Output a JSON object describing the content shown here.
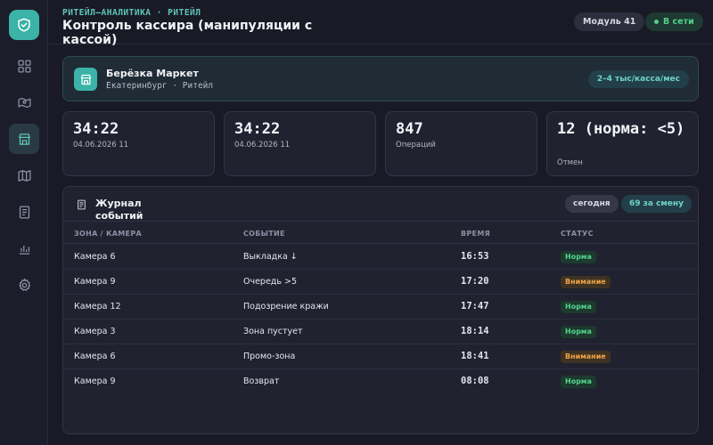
{
  "header": {
    "breadcrumb": "РИТЕЙЛ–АНАЛИТИКА · РИТЕЙЛ",
    "title": "Контроль кассира (манипуляции с кассой)",
    "module_chip": "Модуль 41",
    "online_chip": "В сети"
  },
  "sidebar": {
    "logo_icon": "shield-check-icon",
    "items": [
      {
        "icon": "dashboard-icon",
        "active": false
      },
      {
        "icon": "map-pin-icon",
        "active": false
      },
      {
        "icon": "store-icon",
        "active": true
      },
      {
        "icon": "map-icon",
        "active": false
      },
      {
        "icon": "document-icon",
        "active": false
      },
      {
        "icon": "bar-chart-icon",
        "active": false
      },
      {
        "icon": "gear-icon",
        "active": false
      }
    ]
  },
  "store": {
    "icon": "store-icon",
    "name": "Берёзка Маркет",
    "subtitle": "Екатеринбург · Ритейл",
    "badge": "2–4 тыс/касса/мес"
  },
  "stats": [
    {
      "value": "34:22",
      "label": "04.06.2026 11"
    },
    {
      "value": "34:22",
      "label": "04.06.2026 11"
    },
    {
      "value": "847",
      "label": "Операций"
    },
    {
      "value": "12 (норма: <5)",
      "label": "Отмен"
    }
  ],
  "journal": {
    "icon": "document-icon",
    "title": "Журнал событий",
    "filter_today": "сегодня",
    "shift_count": "69 за смену",
    "columns": [
      "ЗОНА / КАМЕРА",
      "СОБЫТИЕ",
      "ВРЕМЯ",
      "СТАТУС"
    ],
    "rows": [
      {
        "zone": "Камера 6",
        "event": "Выкладка ↓",
        "time": "16:53",
        "status": "Норма",
        "kind": "ok"
      },
      {
        "zone": "Камера 9",
        "event": "Очередь >5",
        "time": "17:20",
        "status": "Внимание",
        "kind": "warn"
      },
      {
        "zone": "Камера 12",
        "event": "Подозрение кражи",
        "time": "17:47",
        "status": "Норма",
        "kind": "ok"
      },
      {
        "zone": "Камера 3",
        "event": "Зона пустует",
        "time": "18:14",
        "status": "Норма",
        "kind": "ok"
      },
      {
        "zone": "Камера 6",
        "event": "Промо-зона",
        "time": "18:41",
        "status": "Внимание",
        "kind": "warn"
      },
      {
        "zone": "Камера 9",
        "event": "Возврат",
        "time": "08:08",
        "status": "Норма",
        "kind": "ok"
      }
    ]
  },
  "colors": {
    "accent": "#3bb3a7",
    "ok": "#53d58d",
    "warn": "#f0a547",
    "background": "#191a26"
  }
}
